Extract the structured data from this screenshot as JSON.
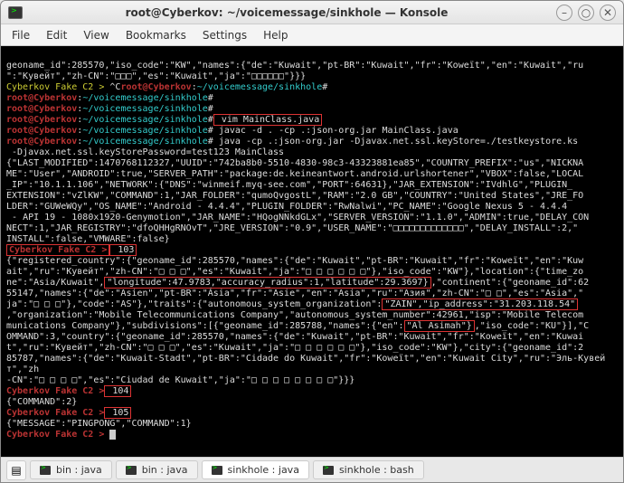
{
  "window": {
    "title": "root@Cyberkov: ~/voicemessage/sinkhole — Konsole",
    "min": "–",
    "max": "○",
    "close": "✕"
  },
  "menu": {
    "file": "File",
    "edit": "Edit",
    "view": "View",
    "bookmarks": "Bookmarks",
    "settings": "Settings",
    "help": "Help"
  },
  "term": {
    "l1": "geoname_id\":285570,\"iso_code\":\"KW\",\"names\":{\"de\":\"Kuwait\",\"pt-BR\":\"Kuwait\",\"fr\":\"Koweït\",\"en\":\"Kuwait\",\"ru",
    "l2": "\":\"Кувейт\",\"zh-CN\":\"□□□\",\"es\":\"Kuwait\",\"ja\":\"□□□□□□\"}}}",
    "l3a": "Cyberkov Fake C2 > ",
    "l3b": "^C",
    "l3c": "root@Cyberkov",
    "l3d": ":",
    "l3e": "~/voicemessage/sinkhole",
    "l3f": "#",
    "l4a": "root@Cyberkov",
    "l4b": ":",
    "l4c": "~/voicemessage/sinkhole",
    "l4d": "#",
    "l5a": "root@Cyberkov",
    "l5b": ":",
    "l5c": "~/voicemessage/sinkhole",
    "l5d": "#",
    "l6a": "root@Cyberkov",
    "l6b": ":",
    "l6c": "~/voicemessage/sinkhole",
    "l6d": "#",
    "l6e": " vim MainClass.java",
    "l7a": "root@Cyberkov",
    "l7b": ":",
    "l7c": "~/voicemessage/sinkhole",
    "l7d": "# javac -d . -cp .:json-org.jar MainClass.java",
    "l8a": "root@Cyberkov",
    "l8b": ":",
    "l8c": "~/voicemessage/sinkhole",
    "l8d": "# java -cp .:json-org.jar -Djavax.net.ssl.keyStore=./testkeystore.ks",
    "l9": " -Djavax.net.ssl.keyStorePassword=test123 MainClass",
    "l10": "{\"LAST_MODIFIED\":1470768112327,\"UUID\":\"742ba8b0-5510-4830-98c3-43323881ea85\",\"COUNTRY_PREFIX\":\"us\",\"NICKNA",
    "l11": "ME\":\"User\",\"ANDROID\":true,\"SERVER_PATH\":\"package:de.keineantwort.android.urlshortener\",\"VBOX\":false,\"LOCAL",
    "l12": "_IP\":\"10.1.1.106\",\"NETWORK\":{\"DNS\":\"winmeif.myq-see.com\",\"PORT\":64631},\"JAR_EXTENSION\":\"IVdhlG\",\"PLUGIN_",
    "l13": "EXTENSION\":\"vZlKW\",\"COMMAND\":1,\"JAR_FOLDER\":\"qumoQvgostL\",\"RAM\":\"2.0 GB\",\"COUNTRY\":\"United States\",\"JRE_FO",
    "l14": "LDER\":\"GUWeWQy\",\"OS_NAME\":\"Android - 4.4.4\",\"PLUGIN_FOLDER\":\"RwNalwi\",\"PC_NAME\":\"Google Nexus 5 - 4.4.4",
    "l15": " - API 19 - 1080x1920-Genymotion\",\"JAR_NAME\":\"HQogNNkdGLx\",\"SERVER_VERSION\":\"1.1.0\",\"ADMIN\":true,\"DELAY_CON",
    "l16": "NECT\":1,\"JAR_REGISTRY\":\"dfoQHHgRNOvT\",\"JRE_VERSION\":\"0.9\",\"USER_NAME\":\"□□□□□□□□□□□□□\",\"DELAY_INSTALL\":2,\"",
    "l17": "INSTALL\":false,\"VMWARE\":false}",
    "l18a": "Cyberkov Fake C2 >",
    "l18b": " 103",
    "l19": "{\"registered_country\":{\"geoname_id\":285570,\"names\":{\"de\":\"Kuwait\",\"pt-BR\":\"Kuwait\",\"fr\":\"Koweït\",\"en\":\"Kuw",
    "l20a": "ait\",\"ru\":\"Кувейт\",\"zh-CN\":\"□ □ □\",\"es\":\"Kuwait\",\"ja\":\"□ □ □ □ □ □\"},\"iso_code\":\"KW\"},\"location\":{\"time_zo",
    "l21a": "ne\":\"Asia/Kuwait\",",
    "l21b": "\"longitude\":47.9783,\"accuracy_radius\":1,\"latitude\":29.3697}",
    "l21c": ",\"continent\":{\"geoname_id\":62",
    "l22": "55147,\"names\":{\"de\":\"Asien\",\"pt-BR\":\"Ásia\",\"fr\":\"Asie\",\"en\":\"Asia\",\"ru\":\"Азия\",\"zh-CN\":\"□ □\",\"es\":\"Asia\",\"",
    "l23a": "ja\":\"□ □ □\"},\"code\":\"AS\"},\"traits\":{\"autonomous_system_organization\":",
    "l23b": "\"ZAIN\",\"ip_address\":\"31.203.118.54\"",
    "l24a": ",\"organization\":\"Mobile Telecommunications Company\",\"autonomous_system_number\":42961,\"isp\":\"Mobile Telecom",
    "l25a": "munications Company\"},\"subdivisions\":[{\"geoname_id\":285788,\"names\":{\"en\":",
    "l25b": "\"Al Asimah\"}",
    "l25c": ",\"iso_code\":\"KU\"}],\"C",
    "l26": "OMMAND\":3,\"country\":{\"geoname_id\":285570,\"names\":{\"de\":\"Kuwait\",\"pt-BR\":\"Kuwait\",\"fr\":\"Koweït\",\"en\":\"Kuwai",
    "l27": "t\",\"ru\":\"Кувейт\",\"zh-CN\":\"□ □ □\",\"es\":\"Kuwait\",\"ja\":\"□ □ □ □ □ □\"},\"iso_code\":\"KW\"},\"city\":{\"geoname_id\":2",
    "l28": "85787,\"names\":{\"de\":\"Kuwait-Stadt\",\"pt-BR\":\"Cidade do Kuwait\",\"fr\":\"Koweït\",\"en\":\"Kuwait City\",\"ru\":\"Эль-Кувейт\",\"zh",
    "l29": "-CN\":\"□ □ □ □\",\"es\":\"Ciudad de Kuwait\",\"ja\":\"□ □ □ □ □ □ □ □\"}}}",
    "l30a": "Cyberkov Fake C2 >",
    "l30b": " 104",
    "l31": "{\"COMMAND\":2}",
    "l32a": "Cyberkov Fake C2 >",
    "l32b": " 105",
    "l33": "{\"MESSAGE\":\"PINGPONG\",\"COMMAND\":1}",
    "l34": "Cyberkov Fake C2 >"
  },
  "tabs": {
    "new_icon": "▤",
    "t1": "bin : java",
    "t2": "bin : java",
    "t3": "sinkhole : java",
    "t4": "sinkhole : bash"
  }
}
